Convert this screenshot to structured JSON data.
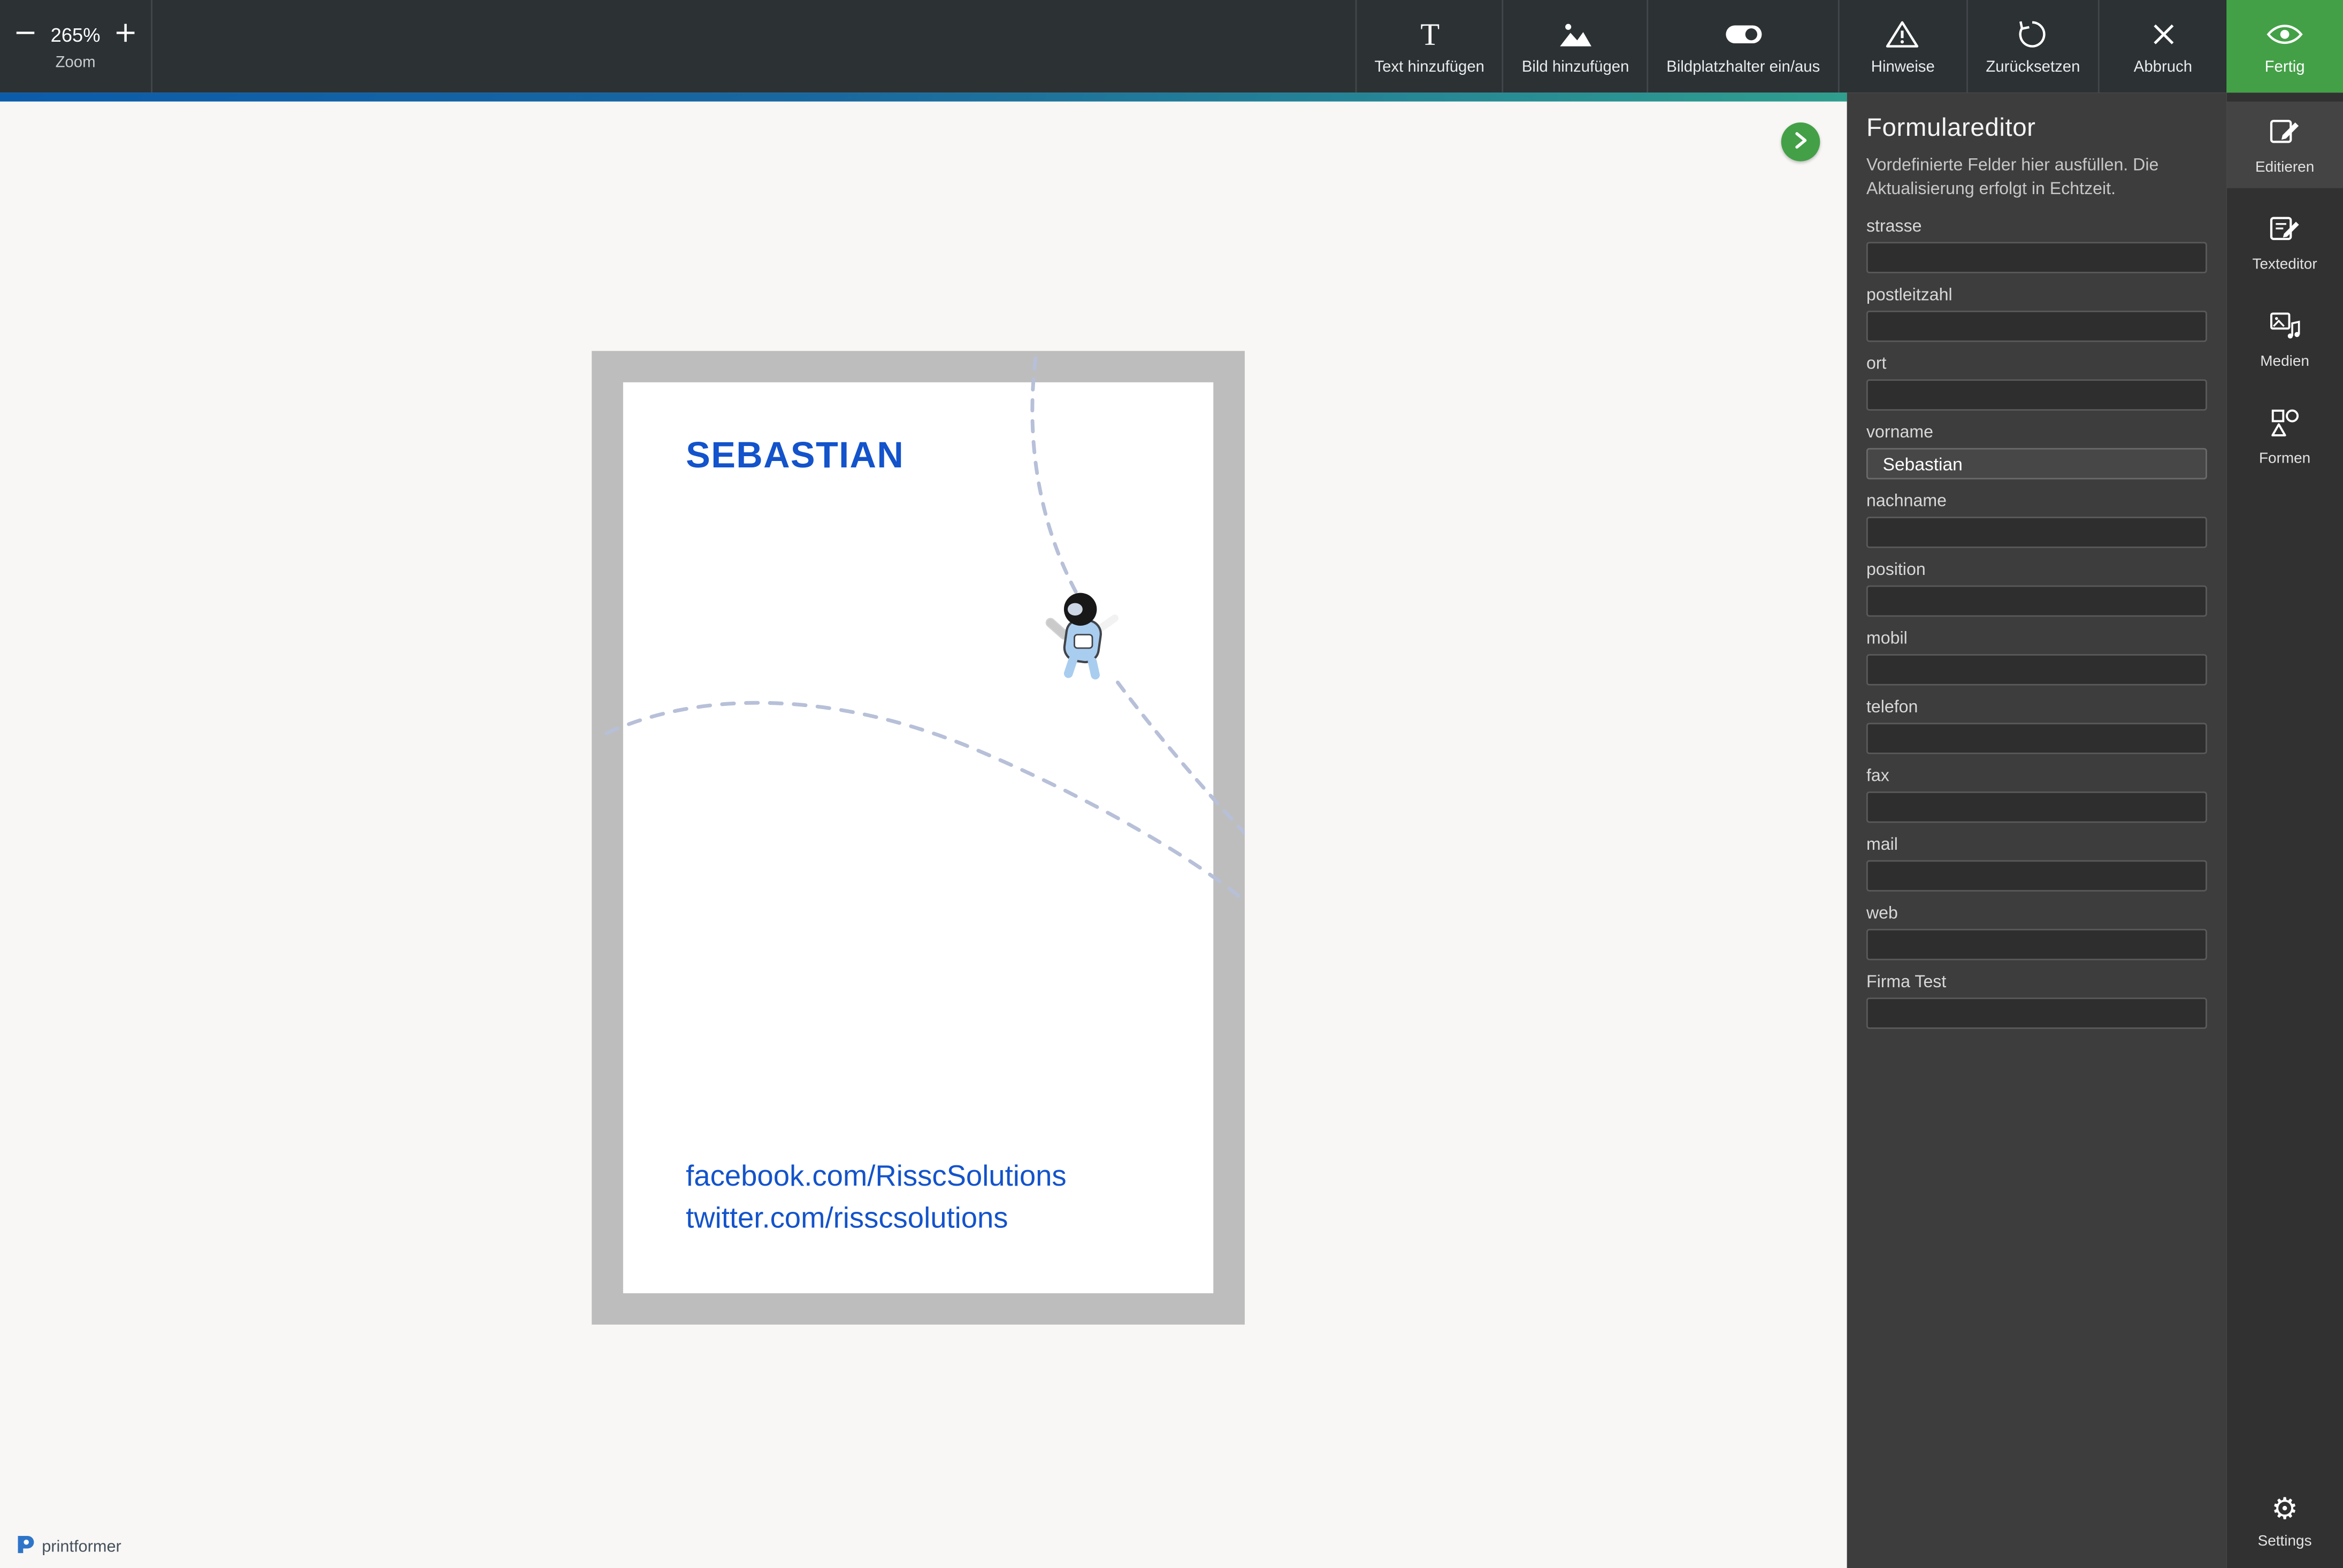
{
  "topbar": {
    "zoom": {
      "value": "265%",
      "label": "Zoom"
    },
    "buttons": [
      {
        "label": "Text hinzufügen"
      },
      {
        "label": "Bild hinzufügen"
      },
      {
        "label": "Bildplatzhalter ein/aus"
      },
      {
        "label": "Hinweise"
      },
      {
        "label": "Zurücksetzen"
      },
      {
        "label": "Abbruch"
      }
    ],
    "done": {
      "label": "Fertig"
    }
  },
  "canvas": {
    "card": {
      "name_text": "SEBASTIAN",
      "facebook_line": "facebook.com/RisscSolutions",
      "twitter_line": "twitter.com/risscsolutions"
    }
  },
  "form_panel": {
    "title": "Formulareditor",
    "subtitle": "Vordefinierte Felder hier ausfüllen. Die Aktualisierung erfolgt in Echtzeit.",
    "fields": [
      {
        "label": "strasse",
        "value": ""
      },
      {
        "label": "postleitzahl",
        "value": ""
      },
      {
        "label": "ort",
        "value": ""
      },
      {
        "label": "vorname",
        "value": "Sebastian"
      },
      {
        "label": "nachname",
        "value": ""
      },
      {
        "label": "position",
        "value": ""
      },
      {
        "label": "mobil",
        "value": ""
      },
      {
        "label": "telefon",
        "value": ""
      },
      {
        "label": "fax",
        "value": ""
      },
      {
        "label": "mail",
        "value": ""
      },
      {
        "label": "web",
        "value": ""
      },
      {
        "label": "Firma Test",
        "value": ""
      }
    ]
  },
  "rail": {
    "items": [
      {
        "label": "Editieren"
      },
      {
        "label": "Texteditor"
      },
      {
        "label": "Medien"
      },
      {
        "label": "Formen"
      }
    ],
    "settings_label": "Settings"
  },
  "footer": {
    "brand": "printformer"
  },
  "colors": {
    "accent_green": "#43a047",
    "gradient_start": "#0b5cab",
    "gradient_end": "#2f9e8e",
    "link_blue": "#1353cb"
  }
}
